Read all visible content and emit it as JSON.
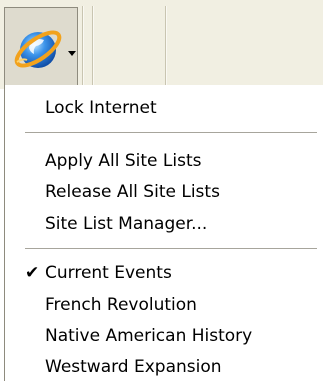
{
  "toolbar": {
    "button": {
      "icon": "internet-explorer-globe-icon",
      "dropdown_icon": "dropdown-arrow-icon"
    }
  },
  "menu": {
    "items": [
      {
        "label": "Lock Internet",
        "checked": false
      },
      {
        "label": "Apply All Site Lists",
        "checked": false
      },
      {
        "label": "Release All Site Lists",
        "checked": false
      },
      {
        "label": "Site List Manager...",
        "checked": false
      },
      {
        "label": "Current Events",
        "checked": true,
        "check_glyph": "✔"
      },
      {
        "label": "French Revolution",
        "checked": false
      },
      {
        "label": "Native American History",
        "checked": false
      },
      {
        "label": "Westward Expansion",
        "checked": false
      }
    ]
  },
  "colors": {
    "toolbar_bg": "#f1efe2",
    "menu_bg": "#ffffff",
    "globe_blue": "#2a7fe0",
    "orbit_orange": "#f2a21c"
  }
}
